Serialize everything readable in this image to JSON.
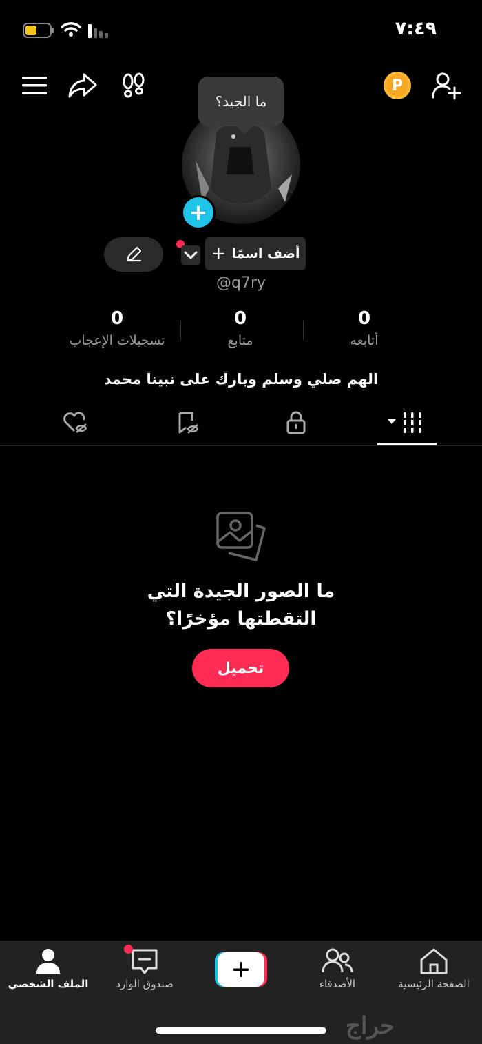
{
  "status_bar": {
    "time": "٧:٤٩"
  },
  "header": {
    "coin_label": "P"
  },
  "tooltip": {
    "text": "ما الجيد؟"
  },
  "profile": {
    "add_name_label": "أضف اسمًا",
    "username": "@q7ry",
    "bio": "الهم صلي وسلم وبارك على نبينا محمد"
  },
  "stats": [
    {
      "value": "0",
      "label": "أتابعه"
    },
    {
      "value": "0",
      "label": "متابع"
    },
    {
      "value": "0",
      "label": "تسجيلات الإعجاب"
    }
  ],
  "tabs": [
    "videos-grid",
    "private",
    "favorites",
    "liked"
  ],
  "empty_state": {
    "line1": "ما الصور الجيدة التي",
    "line2": "التقطتها مؤخرًا؟",
    "button": "تحميل"
  },
  "bottom_nav": {
    "home": "الصفحة الرئيسية",
    "friends": "الأصدقاء",
    "create": "+",
    "inbox": "صندوق الوارد",
    "profile": "الملف الشخصي"
  },
  "watermark": "حراج",
  "colors": {
    "accent": "#fe2c55",
    "cyan": "#20c4e8",
    "coin": "#f5a623"
  }
}
